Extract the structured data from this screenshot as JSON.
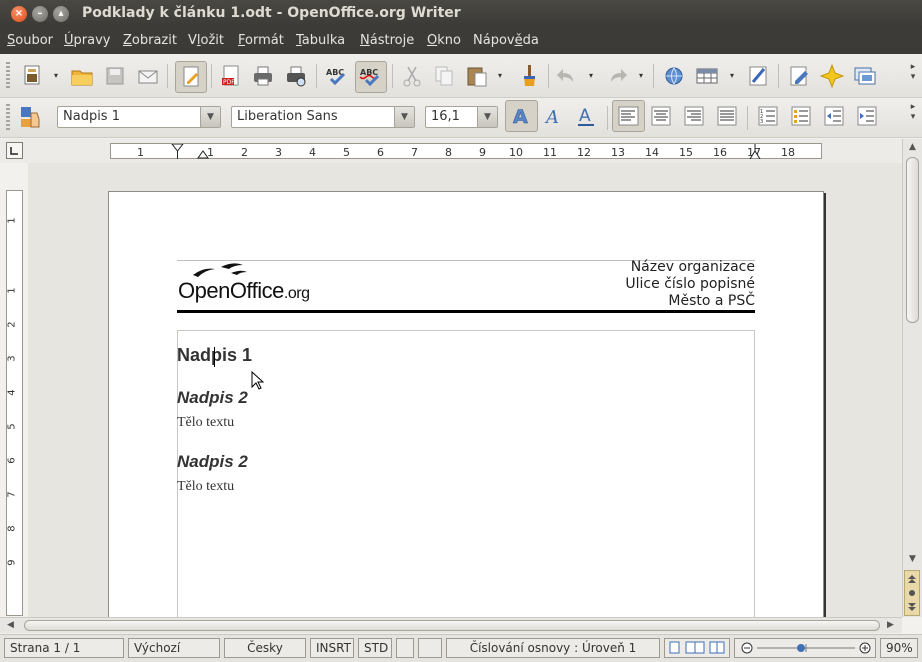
{
  "window": {
    "title": "Podklady k článku 1.odt - OpenOffice.org Writer"
  },
  "menu": [
    {
      "label": "Soubor",
      "u": "S",
      "rest": "oubor"
    },
    {
      "label": "Úpravy",
      "u": "Ú",
      "rest": "pravy"
    },
    {
      "label": "Zobrazit",
      "u": "Z",
      "rest": "obrazit"
    },
    {
      "label": "Vložit",
      "pre": "V",
      "u": "l",
      "rest": "ožit"
    },
    {
      "label": "Formát",
      "u": "F",
      "rest": "ormát"
    },
    {
      "label": "Tabulka",
      "u": "T",
      "rest": "abulka"
    },
    {
      "label": "Nástroje",
      "u": "N",
      "rest": "ástroje"
    },
    {
      "label": "Okno",
      "u": "O",
      "rest": "kno"
    },
    {
      "label": "Nápověda",
      "pre": "Nápov",
      "u": "ě",
      "rest": "da"
    }
  ],
  "formatting": {
    "paragraph_style": "Nadpis 1",
    "font_name": "Liberation Sans",
    "font_size": "16,1"
  },
  "ruler": {
    "h_ticks": [
      "1",
      "1",
      "2",
      "3",
      "4",
      "5",
      "6",
      "7",
      "8",
      "9",
      "10",
      "11",
      "12",
      "13",
      "14",
      "15",
      "16",
      "17",
      "18"
    ],
    "v_ticks": [
      "1",
      "1",
      "2",
      "3",
      "4",
      "5",
      "6",
      "7",
      "8",
      "9"
    ]
  },
  "document": {
    "logo_text_main": "OpenOffice",
    "logo_text_suffix": ".org",
    "org_name": "Název organizace",
    "org_street": "Ulice číslo popisné",
    "org_city": "Město a PSČ",
    "heading1": "Nadpis 1",
    "heading2_a": "Nadpis 2",
    "body_a": "Tělo textu",
    "heading2_b": "Nadpis 2",
    "body_b": "Tělo textu"
  },
  "status": {
    "page": "Strana 1 / 1",
    "page_style": "Výchozí",
    "language": "Česky",
    "insert_mode": "INSRT",
    "selection_mode": "STD",
    "outline": "Číslování osnovy : Úroveň 1",
    "zoom": "90%"
  },
  "colors": {
    "titlebar": "#3c3b37",
    "close_button": "#df4b17",
    "accent_icon_blue": "#4a78c0"
  }
}
